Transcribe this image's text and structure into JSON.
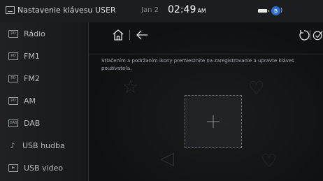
{
  "status_bar": {
    "title": "Nastavenie klávesu USER",
    "date": "Jan 2",
    "time": "02:49",
    "ampm": "AM"
  },
  "sidebar": {
    "items": [
      {
        "label": "Rádio",
        "icon": "radio-icon",
        "glyph": "RD"
      },
      {
        "label": "FM1",
        "icon": "radio-icon",
        "glyph": "RD"
      },
      {
        "label": "FM2",
        "icon": "radio-icon",
        "glyph": "RD"
      },
      {
        "label": "AM",
        "icon": "radio-icon",
        "glyph": "RD"
      },
      {
        "label": "DAB",
        "icon": "dab-icon",
        "glyph": "DAB"
      },
      {
        "label": "USB hudba",
        "icon": "music-note-icon",
        "glyph": "♪"
      },
      {
        "label": "USB video",
        "icon": "video-icon",
        "glyph": "▶"
      }
    ]
  },
  "main": {
    "hint_text": "Stlačením a podržaním ikony premiestnite na zaregistrovanie a upravte kláves používateľa."
  }
}
